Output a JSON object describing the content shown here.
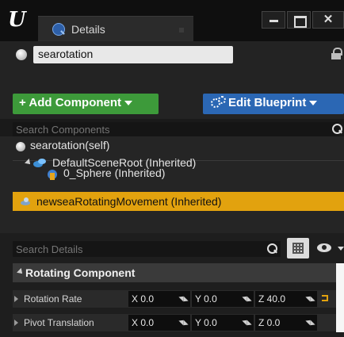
{
  "window": {
    "logo_text": "U",
    "tab_label": "Details",
    "close_glyph": "✕"
  },
  "object": {
    "name": "searotation"
  },
  "toolbar": {
    "add_component_label": "+ Add Component",
    "edit_blueprint_label": "Edit Blueprint"
  },
  "components": {
    "search_placeholder": "Search Components",
    "items": [
      {
        "label": "searotation(self)"
      },
      {
        "label": "DefaultSceneRoot (Inherited)"
      },
      {
        "label": "0_Sphere (Inherited)"
      },
      {
        "label": "newseaRotatingMovement (Inherited)",
        "selected": true
      }
    ]
  },
  "details": {
    "search_placeholder": "Search Details",
    "category": "Rotating Component",
    "properties": [
      {
        "label": "Rotation Rate",
        "x": "X 0.0",
        "y": "Y 0.0",
        "z": "Z 40.0",
        "modified": true
      },
      {
        "label": "Pivot Translation",
        "x": "X 0.0",
        "y": "Y 0.0",
        "z": "Z 0.0",
        "modified": false
      }
    ]
  },
  "colors": {
    "selection": "#e2a20e",
    "add_component": "#3d9a3a",
    "edit_blueprint": "#2b67b4",
    "background": "#1a1a1a"
  },
  "icons": [
    "ue-logo-icon",
    "details-tab-icon",
    "minimize-icon",
    "maximize-icon",
    "close-icon",
    "lock-icon",
    "gears-icon",
    "search-icon",
    "scene-root-icon",
    "sphere-mesh-icon",
    "rotating-movement-icon",
    "grid-view-icon",
    "eye-icon",
    "reset-to-default-icon"
  ]
}
